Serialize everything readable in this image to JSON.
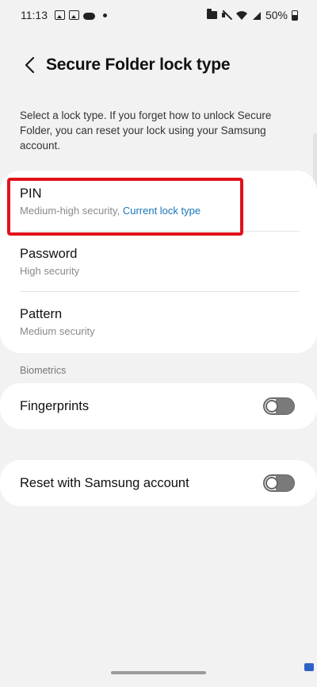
{
  "status_bar": {
    "time": "11:13",
    "battery": "50%"
  },
  "header": {
    "title": "Secure Folder lock type"
  },
  "description": "Select a lock type. If you forget how to unlock Secure Folder, you can reset your lock using your Samsung account.",
  "lock_types": [
    {
      "title": "PIN",
      "subtitle": "Medium-high security,",
      "badge": "Current lock type"
    },
    {
      "title": "Password",
      "subtitle": "High security"
    },
    {
      "title": "Pattern",
      "subtitle": "Medium security"
    }
  ],
  "biometrics": {
    "section_label": "Biometrics",
    "fingerprints": {
      "label": "Fingerprints",
      "enabled": false
    }
  },
  "reset": {
    "label": "Reset with Samsung account",
    "enabled": false
  },
  "colors": {
    "accent": "#1a75b8",
    "highlight": "#e1121b",
    "background": "#f2f2f2"
  }
}
